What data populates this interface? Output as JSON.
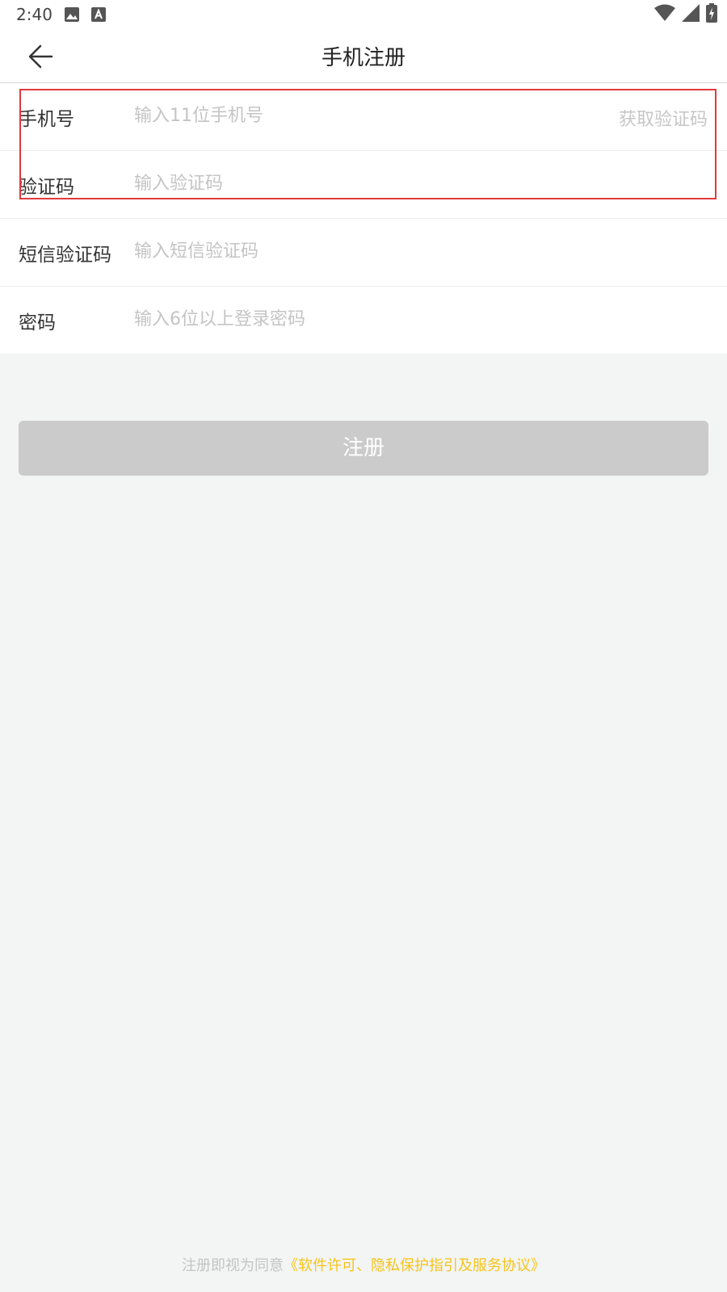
{
  "status_bar": {
    "time": "2:40",
    "left_icons": [
      "image-icon",
      "text-a-icon"
    ],
    "right_icons": [
      "wifi-icon",
      "cellular-signal-icon",
      "battery-charging-icon"
    ]
  },
  "app_bar": {
    "back_icon": "arrow-left-icon",
    "title": "手机注册"
  },
  "form": {
    "phone": {
      "label": "手机号",
      "placeholder": "输入11位手机号",
      "get_code_label": "获取验证码"
    },
    "captcha": {
      "label": "验证码",
      "placeholder": "输入验证码"
    },
    "sms_code": {
      "label": "短信验证码",
      "placeholder": "输入短信验证码"
    },
    "password": {
      "label": "密码",
      "placeholder": "输入6位以上登录密码"
    }
  },
  "register_button": {
    "label": "注册"
  },
  "footer": {
    "prefix": "注册即视为同意",
    "link": "《软件许可、隐私保护指引及服务协议》"
  },
  "colors": {
    "highlight_border": "#e0393e",
    "link": "#f5c518",
    "button_disabled": "#cbcbcb",
    "page_background": "#f3f4f4"
  }
}
